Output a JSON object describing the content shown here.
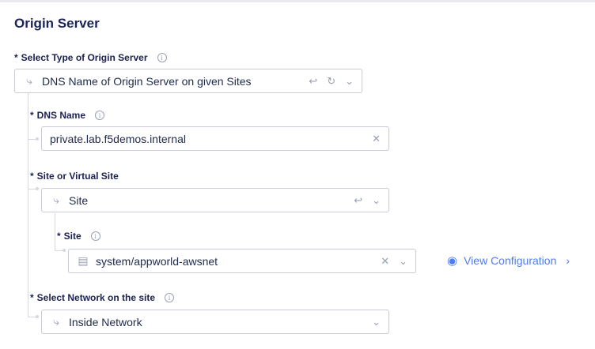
{
  "section_title": "Origin Server",
  "origin_type": {
    "label": "Select Type of Origin Server",
    "value": "DNS Name of Origin Server on given Sites"
  },
  "dns_name": {
    "label": "DNS Name",
    "value": "private.lab.f5demos.internal"
  },
  "site_or_virtual": {
    "label": "Site or Virtual Site",
    "value": "Site"
  },
  "site": {
    "label": "Site",
    "value": "system/appworld-awsnet",
    "view_config": "View Configuration"
  },
  "network": {
    "label": "Select Network on the site",
    "value": "Inside Network"
  },
  "required_marker": "*",
  "colors": {
    "accent": "#4f7cf0",
    "heading": "#1b2458"
  }
}
